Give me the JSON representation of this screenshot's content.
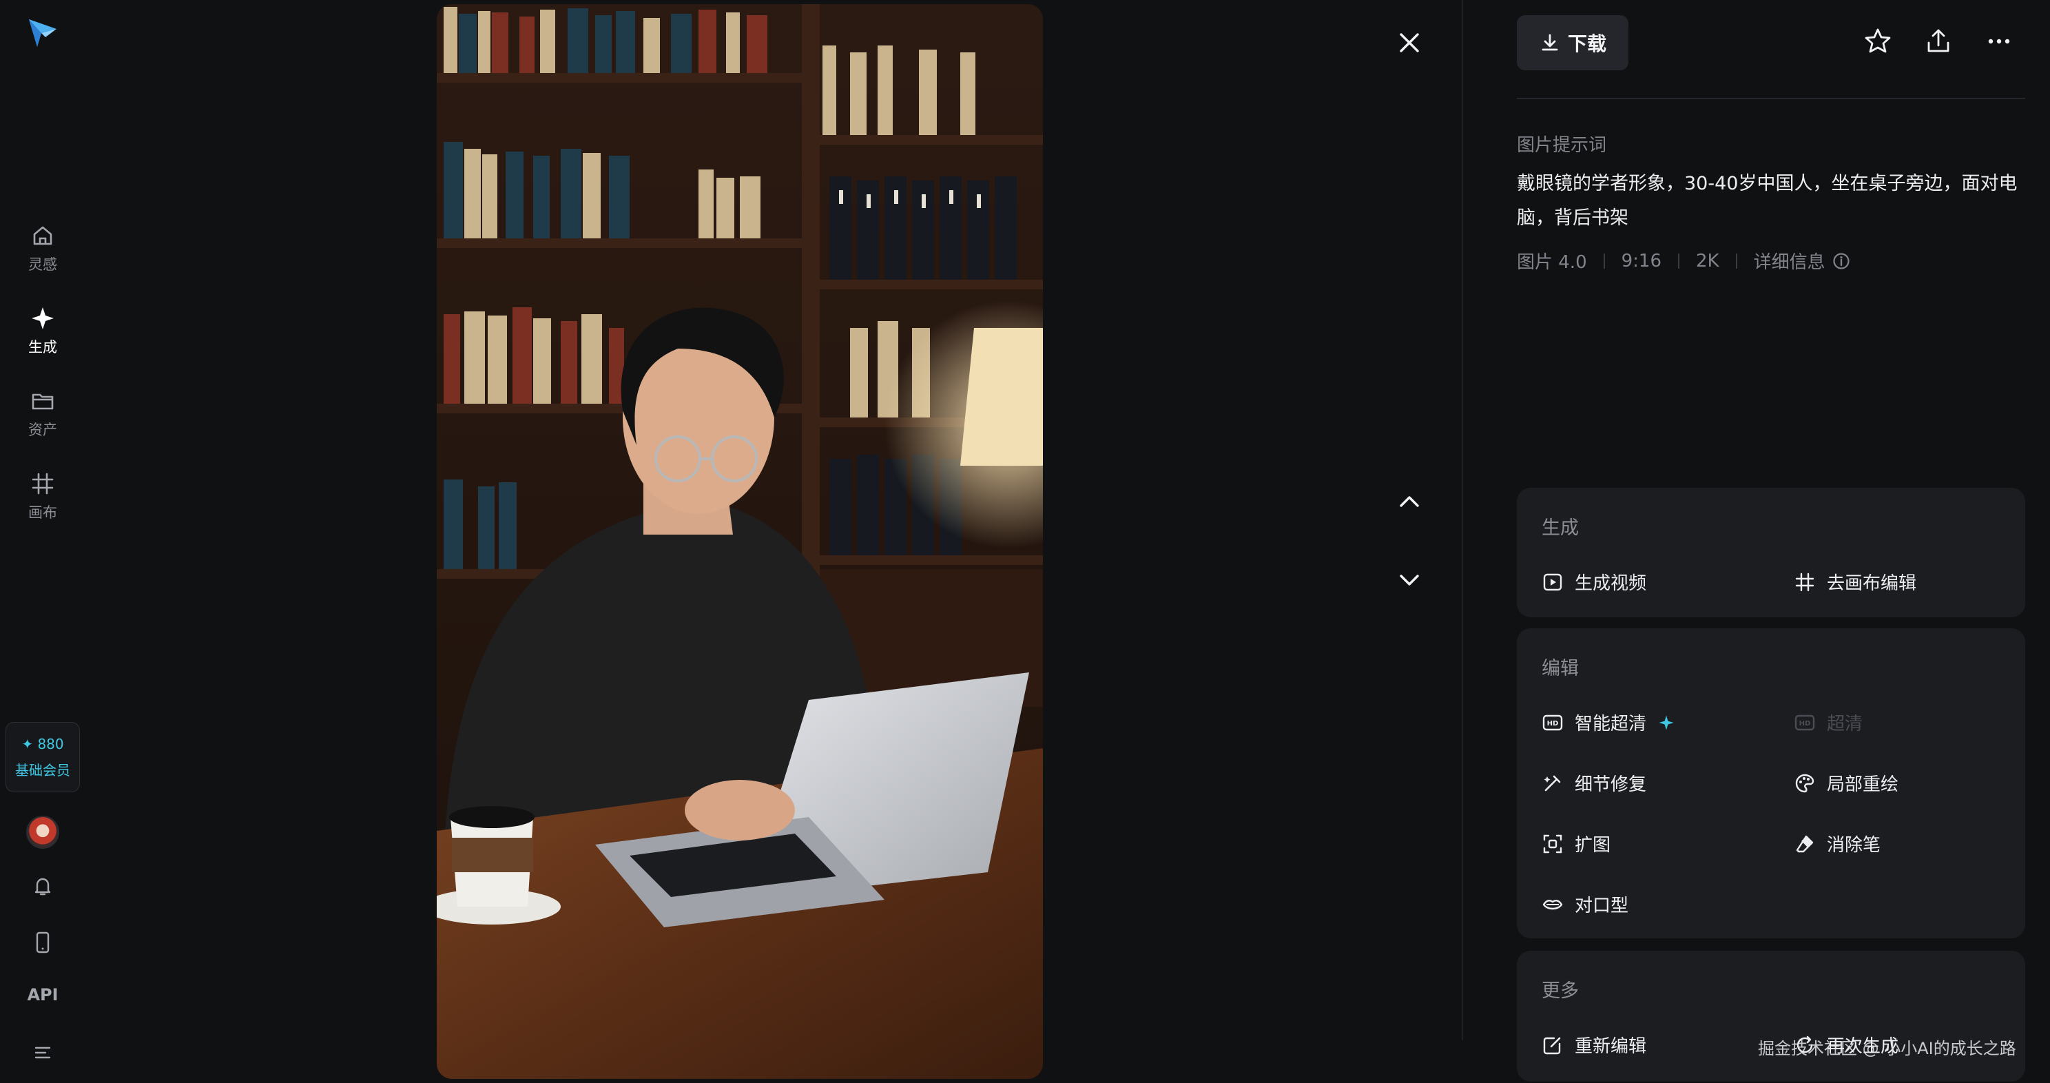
{
  "nav": {
    "items": [
      {
        "label": "灵感",
        "icon": "home-icon"
      },
      {
        "label": "生成",
        "icon": "sparkle-icon",
        "active": true
      },
      {
        "label": "资产",
        "icon": "folder-icon"
      },
      {
        "label": "画布",
        "icon": "canvas-icon"
      }
    ],
    "member": {
      "points": "✦ 880",
      "tier": "基础会员"
    },
    "api_label": "API"
  },
  "toolbar": {
    "download_label": "下载"
  },
  "prompt": {
    "title": "图片提示词",
    "text": "戴眼镜的学者形象，30-40岁中国人，坐在桌子旁边，面对电脑，背后书架",
    "meta": [
      "图片 4.0",
      "9:16",
      "2K"
    ],
    "details_label": "详细信息"
  },
  "generate_card": {
    "title": "生成",
    "actions": [
      "生成视频",
      "去画布编辑"
    ]
  },
  "edit_card": {
    "title": "编辑",
    "actions": [
      "智能超清",
      "超清",
      "细节修复",
      "局部重绘",
      "扩图",
      "消除笔",
      "对口型"
    ]
  },
  "more_card": {
    "title": "更多",
    "actions": [
      "重新编辑",
      "再次生成"
    ]
  },
  "watermark": "掘金技术社区 @ 小小AI的成长之路",
  "colors": {
    "accent": "#3ec7e3",
    "background": "#101113",
    "card": "#1c1d21"
  }
}
